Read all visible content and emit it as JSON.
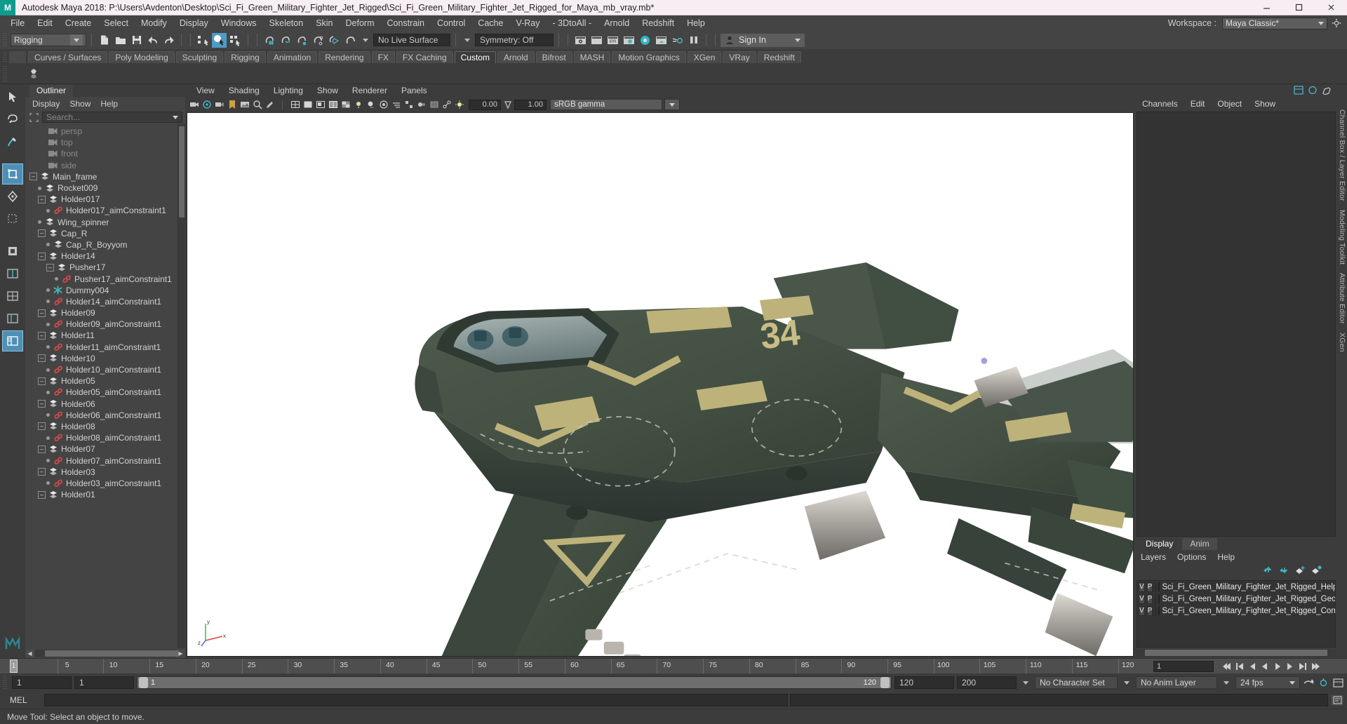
{
  "titlebar": {
    "app_icon": "maya-logo-icon",
    "title": "Autodesk Maya 2018: P:\\Users\\Avdenton\\Desktop\\Sci_Fi_Green_Military_Fighter_Jet_Rigged\\Sci_Fi_Green_Military_Fighter_Jet_Rigged_for_Maya_mb_vray.mb*",
    "minimize": "minimize-icon",
    "maximize": "maximize-icon",
    "close": "close-icon"
  },
  "menubar": {
    "items": [
      "File",
      "Edit",
      "Create",
      "Select",
      "Modify",
      "Display",
      "Windows",
      "Skeleton",
      "Skin",
      "Deform",
      "Constrain",
      "Control",
      "Cache",
      "V-Ray",
      "- 3DtoAll -",
      "Arnold",
      "Redshift",
      "Help"
    ],
    "workspace_label": "Workspace :",
    "workspace_value": "Maya Classic*"
  },
  "statusline": {
    "mode": "Rigging",
    "live_surface": "No Live Surface",
    "symmetry": "Symmetry: Off",
    "signin": "Sign In"
  },
  "shelf": {
    "tabs": [
      "Curves / Surfaces",
      "Poly Modeling",
      "Sculpting",
      "Rigging",
      "Animation",
      "Rendering",
      "FX",
      "FX Caching",
      "Custom",
      "Arnold",
      "Bifrost",
      "MASH",
      "Motion Graphics",
      "XGen",
      "VRay",
      "Redshift"
    ],
    "active_tab": "Custom"
  },
  "outliner": {
    "tab": "Outliner",
    "menu": [
      "Display",
      "Show",
      "Help"
    ],
    "search_placeholder": "Search...",
    "nodes": [
      {
        "label": "persp",
        "depth": 1,
        "icon": "camera-icon",
        "expander": "none",
        "dim": true
      },
      {
        "label": "top",
        "depth": 1,
        "icon": "camera-icon",
        "expander": "none",
        "dim": true
      },
      {
        "label": "front",
        "depth": 1,
        "icon": "camera-icon",
        "expander": "none",
        "dim": true
      },
      {
        "label": "side",
        "depth": 1,
        "icon": "camera-icon",
        "expander": "none",
        "dim": true
      },
      {
        "label": "Main_frame",
        "depth": 0,
        "icon": "transform-icon",
        "expander": "minus",
        "dim": false
      },
      {
        "label": "Rocket009",
        "depth": 1,
        "icon": "transform-icon",
        "expander": "dot",
        "dim": false
      },
      {
        "label": "Holder017",
        "depth": 1,
        "icon": "transform-icon",
        "expander": "minus",
        "dim": false
      },
      {
        "label": "Holder017_aimConstraint1",
        "depth": 2,
        "icon": "constraint-icon",
        "expander": "dot",
        "dim": false
      },
      {
        "label": "Wing_spinner",
        "depth": 1,
        "icon": "transform-icon",
        "expander": "dot",
        "dim": false
      },
      {
        "label": "Cap_R",
        "depth": 1,
        "icon": "transform-icon",
        "expander": "minus",
        "dim": false
      },
      {
        "label": "Cap_R_Boyyom",
        "depth": 2,
        "icon": "transform-icon",
        "expander": "dot",
        "dim": false
      },
      {
        "label": "Holder14",
        "depth": 1,
        "icon": "transform-icon",
        "expander": "minus",
        "dim": false
      },
      {
        "label": "Pusher17",
        "depth": 2,
        "icon": "transform-icon",
        "expander": "minus",
        "dim": false
      },
      {
        "label": "Pusher17_aimConstraint1",
        "depth": 3,
        "icon": "constraint-icon",
        "expander": "dot",
        "dim": false
      },
      {
        "label": "Dummy004",
        "depth": 2,
        "icon": "locator-icon",
        "expander": "dot",
        "dim": false
      },
      {
        "label": "Holder14_aimConstraint1",
        "depth": 2,
        "icon": "constraint-icon",
        "expander": "dot",
        "dim": false
      },
      {
        "label": "Holder09",
        "depth": 1,
        "icon": "transform-icon",
        "expander": "minus",
        "dim": false
      },
      {
        "label": "Holder09_aimConstraint1",
        "depth": 2,
        "icon": "constraint-icon",
        "expander": "dot",
        "dim": false
      },
      {
        "label": "Holder11",
        "depth": 1,
        "icon": "transform-icon",
        "expander": "minus",
        "dim": false
      },
      {
        "label": "Holder11_aimConstraint1",
        "depth": 2,
        "icon": "constraint-icon",
        "expander": "dot",
        "dim": false
      },
      {
        "label": "Holder10",
        "depth": 1,
        "icon": "transform-icon",
        "expander": "minus",
        "dim": false
      },
      {
        "label": "Holder10_aimConstraint1",
        "depth": 2,
        "icon": "constraint-icon",
        "expander": "dot",
        "dim": false
      },
      {
        "label": "Holder05",
        "depth": 1,
        "icon": "transform-icon",
        "expander": "minus",
        "dim": false
      },
      {
        "label": "Holder05_aimConstraint1",
        "depth": 2,
        "icon": "constraint-icon",
        "expander": "dot",
        "dim": false
      },
      {
        "label": "Holder06",
        "depth": 1,
        "icon": "transform-icon",
        "expander": "minus",
        "dim": false
      },
      {
        "label": "Holder06_aimConstraint1",
        "depth": 2,
        "icon": "constraint-icon",
        "expander": "dot",
        "dim": false
      },
      {
        "label": "Holder08",
        "depth": 1,
        "icon": "transform-icon",
        "expander": "minus",
        "dim": false
      },
      {
        "label": "Holder08_aimConstraint1",
        "depth": 2,
        "icon": "constraint-icon",
        "expander": "dot",
        "dim": false
      },
      {
        "label": "Holder07",
        "depth": 1,
        "icon": "transform-icon",
        "expander": "minus",
        "dim": false
      },
      {
        "label": "Holder07_aimConstraint1",
        "depth": 2,
        "icon": "constraint-icon",
        "expander": "dot",
        "dim": false
      },
      {
        "label": "Holder03",
        "depth": 1,
        "icon": "transform-icon",
        "expander": "minus",
        "dim": false
      },
      {
        "label": "Holder03_aimConstraint1",
        "depth": 2,
        "icon": "constraint-icon",
        "expander": "dot",
        "dim": false
      },
      {
        "label": "Holder01",
        "depth": 1,
        "icon": "transform-icon",
        "expander": "minus",
        "dim": false
      }
    ]
  },
  "viewport": {
    "menu": [
      "View",
      "Shading",
      "Lighting",
      "Show",
      "Renderer",
      "Panels"
    ],
    "exposure": "0.00",
    "gamma": "1.00",
    "color_space": "sRGB gamma",
    "axis_labels": [
      "y",
      "x",
      "z"
    ]
  },
  "right_panel": {
    "tabs": [
      "Channels",
      "Edit",
      "Object",
      "Show"
    ],
    "vertical_tabs": [
      "Channel Box / Layer Editor",
      "Modeling Toolkit",
      "Attribute Editor",
      "XGen"
    ]
  },
  "layer_editor": {
    "tabs": [
      "Display",
      "Anim"
    ],
    "active_tab": "Display",
    "menu": [
      "Layers",
      "Options",
      "Help"
    ],
    "layers": [
      {
        "v": "V",
        "p": "P",
        "color": "#1414e0",
        "name": "Sci_Fi_Green_Military_Fighter_Jet_Rigged_Help"
      },
      {
        "v": "V",
        "p": "P",
        "color": "#f2f24a",
        "name": "Sci_Fi_Green_Military_Fighter_Jet_Rigged_Geom"
      },
      {
        "v": "V",
        "p": "P",
        "color": "#b4142e",
        "name": "Sci_Fi_Green_Military_Fighter_Jet_Rigged_Contro"
      }
    ]
  },
  "timeline": {
    "ticks": [
      5,
      10,
      15,
      20,
      25,
      30,
      35,
      40,
      45,
      50,
      55,
      60,
      65,
      70,
      75,
      80,
      85,
      90,
      95,
      100,
      105,
      110,
      115,
      120
    ],
    "current_frame": "1",
    "frame_field": "1"
  },
  "range": {
    "start_field": "1",
    "current_field": "1",
    "range_start": "1",
    "range_end": "120",
    "anim_end": "120",
    "playback_end": "200",
    "character_set": "No Character Set",
    "anim_layer": "No Anim Layer",
    "fps": "24 fps"
  },
  "command": {
    "label": "MEL",
    "input_value": "",
    "output_value": ""
  },
  "helpline": {
    "text": "Move Tool: Select an object to move."
  }
}
